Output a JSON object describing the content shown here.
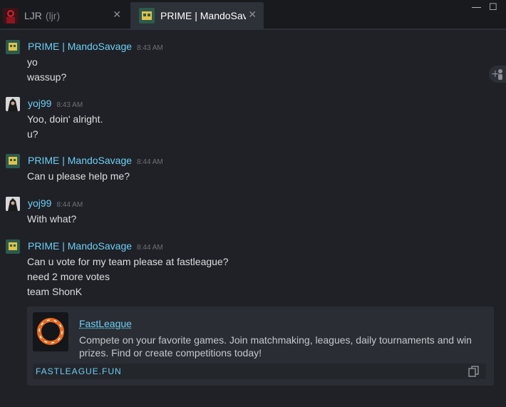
{
  "tabs": [
    {
      "name": "LJR",
      "sub": "(ljr)",
      "close": "✕"
    },
    {
      "name": "PRIME | MandoSavage",
      "close": "✕"
    }
  ],
  "window_controls": {
    "minimize": "—",
    "maximize": "☐"
  },
  "messages": [
    {
      "sender": "PRIME | MandoSavage",
      "time": "8:43 AM",
      "lines": [
        "yo",
        "wassup?"
      ]
    },
    {
      "sender": "yoj99",
      "time": "8:43 AM",
      "lines": [
        "Yoo, doin' alright.",
        "u?"
      ]
    },
    {
      "sender": "PRIME | MandoSavage",
      "time": "8:44 AM",
      "lines": [
        "Can u please help me?"
      ]
    },
    {
      "sender": "yoj99",
      "time": "8:44 AM",
      "lines": [
        "With what?"
      ]
    },
    {
      "sender": "PRIME | MandoSavage",
      "time": "8:44 AM",
      "lines": [
        "Can u vote for my team please at fastleague?",
        "need 2 more votes",
        "team ShonK"
      ]
    }
  ],
  "embed": {
    "title": "FastLeague",
    "description": "Compete on your favorite games. Join matchmaking, leagues, daily tournaments and win prizes. Find or create competitions today!",
    "domain": "FASTLEAGUE.FUN"
  },
  "colors": {
    "accent": "#6dcff6",
    "background": "#1f2126"
  }
}
